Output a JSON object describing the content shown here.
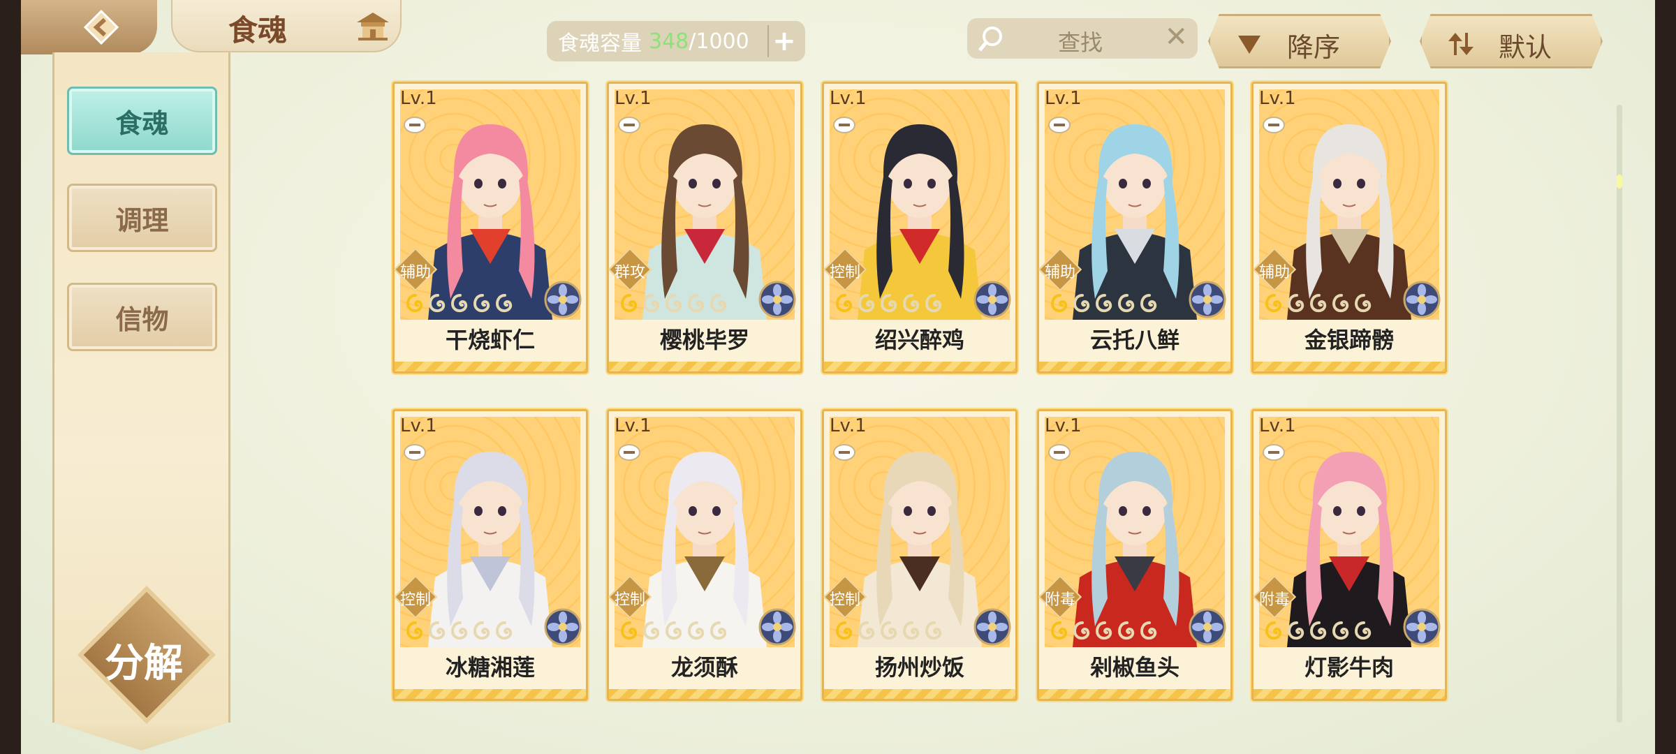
{
  "header": {
    "title": "食魂",
    "capacity_label": "食魂容量",
    "capacity_used": "348",
    "capacity_total": "/1000",
    "capacity_add": "+",
    "search_placeholder": "查找",
    "search_clear": "✕",
    "sort_order_label": "降序",
    "sort_mode_label": "默认"
  },
  "sidebar": {
    "items": [
      {
        "label": "食魂",
        "active": true
      },
      {
        "label": "调理",
        "active": false
      },
      {
        "label": "信物",
        "active": false
      }
    ],
    "decompose_label": "分解"
  },
  "cards": [
    {
      "level": "Lv.1",
      "role": "辅助",
      "name": "干烧虾仁",
      "hair": "#f48aa0",
      "outfit": "#2d3e6a",
      "accent": "#e0402c",
      "stars_filled": 1,
      "stars_total": 5
    },
    {
      "level": "Lv.1",
      "role": "群攻",
      "name": "樱桃毕罗",
      "hair": "#6a4a32",
      "outfit": "#cfe6e0",
      "accent": "#c8283a",
      "stars_filled": 1,
      "stars_total": 5
    },
    {
      "level": "Lv.1",
      "role": "控制",
      "name": "绍兴醉鸡",
      "hair": "#2a2a34",
      "outfit": "#f4c83a",
      "accent": "#d02a2a",
      "stars_filled": 1,
      "stars_total": 5
    },
    {
      "level": "Lv.1",
      "role": "辅助",
      "name": "云托八鲜",
      "hair": "#9fd4e6",
      "outfit": "#2c3440",
      "accent": "#d9dde2",
      "stars_filled": 1,
      "stars_total": 5
    },
    {
      "level": "Lv.1",
      "role": "辅助",
      "name": "金银蹄髈",
      "hair": "#e8e4e0",
      "outfit": "#5a3220",
      "accent": "#d0c0a0",
      "stars_filled": 1,
      "stars_total": 5
    },
    {
      "level": "Lv.1",
      "role": "控制",
      "name": "冰糖湘莲",
      "hair": "#dcdce8",
      "outfit": "#f4f2f0",
      "accent": "#c0c4d8",
      "stars_filled": 1,
      "stars_total": 5
    },
    {
      "level": "Lv.1",
      "role": "控制",
      "name": "龙须酥",
      "hair": "#eceaf0",
      "outfit": "#f6f4ee",
      "accent": "#8a6a3a",
      "stars_filled": 1,
      "stars_total": 5
    },
    {
      "level": "Lv.1",
      "role": "控制",
      "name": "扬州炒饭",
      "hair": "#e8d8b8",
      "outfit": "#f2e8d4",
      "accent": "#4a2e22",
      "stars_filled": 1,
      "stars_total": 5
    },
    {
      "level": "Lv.1",
      "role": "附毒",
      "name": "剁椒鱼头",
      "hair": "#b4cfdc",
      "outfit": "#c8281e",
      "accent": "#3a3a44",
      "stars_filled": 1,
      "stars_total": 5
    },
    {
      "level": "Lv.1",
      "role": "附毒",
      "name": "灯影牛肉",
      "hair": "#f4a0b4",
      "outfit": "#1e1a1e",
      "accent": "#c8282a",
      "stars_filled": 1,
      "stars_total": 5
    }
  ],
  "colors": {
    "card_border": "#e9b450",
    "card_bg": "#ffd27a",
    "active_tab": "#8ed8cc",
    "capacity_used": "#8fe07a"
  }
}
